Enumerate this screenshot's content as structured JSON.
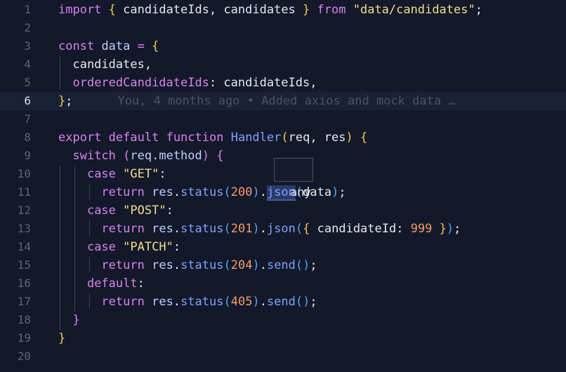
{
  "editor": {
    "active_line": 6,
    "colors": {
      "background": "#13192a",
      "keyword": "#d783ee",
      "function": "#7fa2ff",
      "string": "#f1de89",
      "number": "#f39c6b",
      "variable": "#c3ccff"
    },
    "line_numbers": [
      "1",
      "2",
      "3",
      "4",
      "5",
      "6",
      "7",
      "8",
      "9",
      "10",
      "11",
      "12",
      "13",
      "14",
      "15",
      "16",
      "17",
      "18",
      "19",
      "20"
    ],
    "lines": [
      {
        "tokens": [
          [
            "kw",
            "import"
          ],
          [
            "plain",
            " "
          ],
          [
            "br-yellow",
            "{"
          ],
          [
            "plain",
            " candidateIds, candidates "
          ],
          [
            "br-yellow",
            "}"
          ],
          [
            "plain",
            " "
          ],
          [
            "kw",
            "from"
          ],
          [
            "plain",
            " "
          ],
          [
            "str",
            "\"data/candidates\""
          ],
          [
            "plain",
            ";"
          ]
        ]
      },
      {
        "tokens": []
      },
      {
        "tokens": [
          [
            "kw",
            "const"
          ],
          [
            "plain",
            " "
          ],
          [
            "var",
            "data"
          ],
          [
            "plain",
            " "
          ],
          [
            "kw",
            "="
          ],
          [
            "plain",
            " "
          ],
          [
            "br-yellow",
            "{"
          ]
        ]
      },
      {
        "tokens": [
          [
            "plain",
            "  candidates,"
          ]
        ]
      },
      {
        "tokens": [
          [
            "plain",
            "  "
          ],
          [
            "prop",
            "orderedCandidateIds"
          ],
          [
            "plain",
            ": candidateIds,"
          ]
        ]
      },
      {
        "tokens": [
          [
            "br-yellow",
            "}"
          ],
          [
            "plain",
            ";"
          ]
        ],
        "blame": "You, 4 months ago • Added axios and mock data …"
      },
      {
        "tokens": []
      },
      {
        "tokens": [
          [
            "kw",
            "export"
          ],
          [
            "plain",
            " "
          ],
          [
            "kw",
            "default"
          ],
          [
            "plain",
            " "
          ],
          [
            "kw",
            "function"
          ],
          [
            "plain",
            " "
          ],
          [
            "fn",
            "Handler"
          ],
          [
            "br-yellow",
            "("
          ],
          [
            "plain",
            "req, res"
          ],
          [
            "br-yellow",
            ")"
          ],
          [
            "plain",
            " "
          ],
          [
            "br-yellow",
            "{"
          ]
        ]
      },
      {
        "tokens": [
          [
            "plain",
            "  "
          ],
          [
            "kw",
            "switch"
          ],
          [
            "plain",
            " "
          ],
          [
            "br-purple",
            "("
          ],
          [
            "var",
            "req.method"
          ],
          [
            "br-purple",
            ")"
          ],
          [
            "plain",
            " "
          ],
          [
            "br-purple",
            "{"
          ]
        ]
      },
      {
        "tokens": [
          [
            "plain",
            "    "
          ],
          [
            "kw",
            "case"
          ],
          [
            "plain",
            " "
          ],
          [
            "str",
            "\"GET\""
          ],
          [
            "plain",
            ":"
          ]
        ]
      },
      {
        "tokens": [
          [
            "plain",
            "      "
          ],
          [
            "kw",
            "return"
          ],
          [
            "plain",
            " "
          ],
          [
            "var",
            "res"
          ],
          [
            "plain",
            "."
          ],
          [
            "fn",
            "status"
          ],
          [
            "br-blue",
            "("
          ],
          [
            "num",
            "200"
          ],
          [
            "br-blue",
            ")"
          ],
          [
            "plain",
            "."
          ],
          [
            "hl",
            "json"
          ],
          [
            "br-blue",
            "("
          ],
          [
            "plain",
            "data"
          ],
          [
            "br-blue",
            ")"
          ],
          [
            "plain",
            ";"
          ]
        ]
      },
      {
        "tokens": [
          [
            "plain",
            "    "
          ],
          [
            "kw",
            "case"
          ],
          [
            "plain",
            " "
          ],
          [
            "str",
            "\"POST\""
          ],
          [
            "plain",
            ":"
          ]
        ]
      },
      {
        "tokens": [
          [
            "plain",
            "      "
          ],
          [
            "kw",
            "return"
          ],
          [
            "plain",
            " "
          ],
          [
            "var",
            "res"
          ],
          [
            "plain",
            "."
          ],
          [
            "fn",
            "status"
          ],
          [
            "br-blue",
            "("
          ],
          [
            "num",
            "201"
          ],
          [
            "br-blue",
            ")"
          ],
          [
            "plain",
            "."
          ],
          [
            "fn",
            "json"
          ],
          [
            "br-blue",
            "("
          ],
          [
            "br-yellow",
            "{"
          ],
          [
            "plain",
            " candidateId: "
          ],
          [
            "num",
            "999"
          ],
          [
            "plain",
            " "
          ],
          [
            "br-yellow",
            "}"
          ],
          [
            "br-blue",
            ")"
          ],
          [
            "plain",
            ";"
          ]
        ]
      },
      {
        "tokens": [
          [
            "plain",
            "    "
          ],
          [
            "kw",
            "case"
          ],
          [
            "plain",
            " "
          ],
          [
            "str",
            "\"PATCH\""
          ],
          [
            "plain",
            ":"
          ]
        ]
      },
      {
        "tokens": [
          [
            "plain",
            "      "
          ],
          [
            "kw",
            "return"
          ],
          [
            "plain",
            " "
          ],
          [
            "var",
            "res"
          ],
          [
            "plain",
            "."
          ],
          [
            "fn",
            "status"
          ],
          [
            "br-blue",
            "("
          ],
          [
            "num",
            "204"
          ],
          [
            "br-blue",
            ")"
          ],
          [
            "plain",
            "."
          ],
          [
            "fn",
            "send"
          ],
          [
            "br-blue",
            "()"
          ],
          [
            "plain",
            ";"
          ]
        ]
      },
      {
        "tokens": [
          [
            "plain",
            "    "
          ],
          [
            "kw",
            "default"
          ],
          [
            "plain",
            ":"
          ]
        ]
      },
      {
        "tokens": [
          [
            "plain",
            "      "
          ],
          [
            "kw",
            "return"
          ],
          [
            "plain",
            " "
          ],
          [
            "var",
            "res"
          ],
          [
            "plain",
            "."
          ],
          [
            "fn",
            "status"
          ],
          [
            "br-blue",
            "("
          ],
          [
            "num",
            "405"
          ],
          [
            "br-blue",
            ")"
          ],
          [
            "plain",
            "."
          ],
          [
            "fn",
            "send"
          ],
          [
            "br-blue",
            "()"
          ],
          [
            "plain",
            ";"
          ]
        ]
      },
      {
        "tokens": [
          [
            "plain",
            "  "
          ],
          [
            "br-purple",
            "}"
          ]
        ]
      },
      {
        "tokens": [
          [
            "br-yellow",
            "}"
          ]
        ]
      },
      {
        "tokens": []
      }
    ]
  },
  "hover_tooltip": {
    "text": "any",
    "target_word": "json"
  }
}
